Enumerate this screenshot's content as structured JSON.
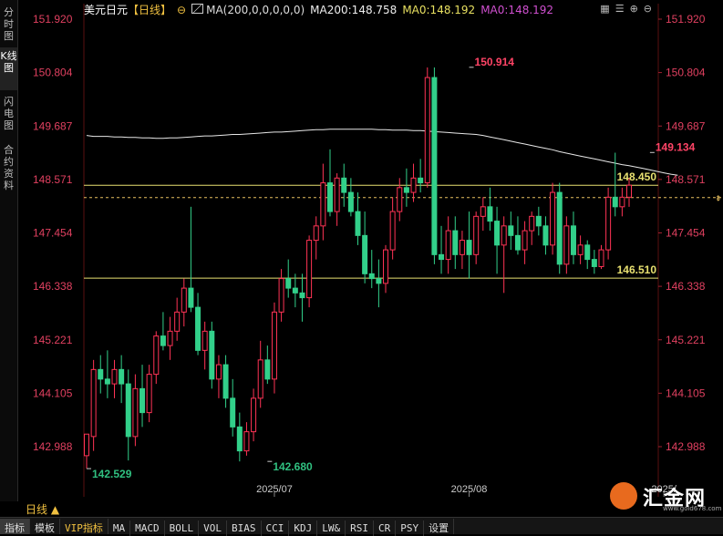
{
  "left_tabs": [
    "分时图",
    "K线图",
    "闪电图",
    "合约资料"
  ],
  "left_active": 1,
  "header": {
    "symbol": "美元日元",
    "period": "【日线】",
    "circle_glyph": "⊖",
    "ma_params": "MA(200,0,0,0,0,0)",
    "ma200": "MA200:148.758",
    "ma0_a": "MA0:148.192",
    "ma0_b": "MA0:148.192"
  },
  "toolbar_icons": [
    "grid-icon",
    "list-icon",
    "zoom-in-icon",
    "zoom-out-icon"
  ],
  "period_tab": "日线 ▲",
  "bottom_tabs": [
    "指标",
    "模板",
    "VIP指标",
    "MA",
    "MACD",
    "BOLL",
    "VOL",
    "BIAS",
    "CCI",
    "KDJ",
    "LW&",
    "RSI",
    "CR",
    "PSY",
    "设置"
  ],
  "bottom_active": 0,
  "logo": {
    "text": "汇金网",
    "url": "www.gold678.com"
  },
  "chart_data": {
    "type": "candlestick",
    "yticks": [
      "151.920",
      "150.804",
      "149.687",
      "148.571",
      "147.454",
      "146.338",
      "145.221",
      "144.105",
      "142.988"
    ],
    "ylim": [
      142.0,
      152.4
    ],
    "xlabels": [
      {
        "index": 27,
        "text": "2025/07"
      },
      {
        "index": 55,
        "text": "2025/08"
      },
      {
        "index": 83,
        "text": "2025/"
      }
    ],
    "annotations": [
      {
        "label": "150.914",
        "value": 150.914,
        "index": 55,
        "color": "#ff4466"
      },
      {
        "label": "149.134",
        "value": 149.134,
        "index": 81,
        "color": "#ff4466"
      },
      {
        "label": "142.529",
        "value": 142.529,
        "index": 0,
        "color": "#30c080"
      },
      {
        "label": "142.680",
        "value": 142.68,
        "index": 26,
        "color": "#30c080"
      }
    ],
    "hlines": [
      {
        "label": "148.450",
        "value": 148.45,
        "color": "#e8e070"
      },
      {
        "label": "146.510",
        "value": 146.51,
        "color": "#e8e070"
      }
    ],
    "current_price": 148.192,
    "ma200": [
      149.49,
      149.47,
      149.47,
      149.47,
      149.46,
      149.46,
      149.45,
      149.45,
      149.44,
      149.44,
      149.43,
      149.43,
      149.44,
      149.44,
      149.45,
      149.46,
      149.47,
      149.48,
      149.48,
      149.49,
      149.5,
      149.51,
      149.51,
      149.52,
      149.53,
      149.54,
      149.55,
      149.56,
      149.56,
      149.57,
      149.58,
      149.59,
      149.6,
      149.61,
      149.61,
      149.62,
      149.62,
      149.62,
      149.62,
      149.62,
      149.62,
      149.62,
      149.61,
      149.61,
      149.6,
      149.6,
      149.6,
      149.59,
      149.59,
      149.58,
      149.57,
      149.56,
      149.55,
      149.54,
      149.53,
      149.52,
      149.51,
      149.49,
      149.46,
      149.43,
      149.4,
      149.37,
      149.34,
      149.31,
      149.28,
      149.25,
      149.22,
      149.19,
      149.15,
      149.12,
      149.09,
      149.06,
      149.03,
      149.0,
      148.97,
      148.94,
      148.91,
      148.88,
      148.86,
      148.83,
      148.8,
      148.77,
      148.74,
      148.71,
      148.68,
      148.66
    ],
    "candles": [
      {
        "o": 142.8,
        "h": 143.2,
        "l": 142.53,
        "c": 143.25
      },
      {
        "o": 143.2,
        "h": 144.8,
        "l": 142.9,
        "c": 144.6
      },
      {
        "o": 144.6,
        "h": 144.9,
        "l": 144.1,
        "c": 144.4
      },
      {
        "o": 144.4,
        "h": 145.0,
        "l": 144.0,
        "c": 144.3
      },
      {
        "o": 144.3,
        "h": 144.8,
        "l": 144.0,
        "c": 144.6
      },
      {
        "o": 144.6,
        "h": 144.9,
        "l": 143.9,
        "c": 144.3
      },
      {
        "o": 144.3,
        "h": 144.6,
        "l": 142.7,
        "c": 143.2
      },
      {
        "o": 143.2,
        "h": 144.5,
        "l": 143.0,
        "c": 144.2
      },
      {
        "o": 144.2,
        "h": 144.7,
        "l": 143.4,
        "c": 143.7
      },
      {
        "o": 143.7,
        "h": 144.7,
        "l": 143.5,
        "c": 144.5
      },
      {
        "o": 144.5,
        "h": 145.4,
        "l": 144.3,
        "c": 145.3
      },
      {
        "o": 145.3,
        "h": 145.8,
        "l": 145.0,
        "c": 145.1
      },
      {
        "o": 145.1,
        "h": 145.7,
        "l": 144.8,
        "c": 145.4
      },
      {
        "o": 145.4,
        "h": 146.1,
        "l": 145.2,
        "c": 145.8
      },
      {
        "o": 145.8,
        "h": 146.5,
        "l": 145.5,
        "c": 146.3
      },
      {
        "o": 146.3,
        "h": 148.0,
        "l": 145.8,
        "c": 145.9
      },
      {
        "o": 145.9,
        "h": 146.2,
        "l": 144.9,
        "c": 145.0
      },
      {
        "o": 145.0,
        "h": 145.6,
        "l": 144.6,
        "c": 145.4
      },
      {
        "o": 145.4,
        "h": 145.6,
        "l": 144.2,
        "c": 144.4
      },
      {
        "o": 144.4,
        "h": 144.9,
        "l": 144.0,
        "c": 144.7
      },
      {
        "o": 144.7,
        "h": 144.9,
        "l": 143.8,
        "c": 144.0
      },
      {
        "o": 144.0,
        "h": 144.4,
        "l": 143.2,
        "c": 143.4
      },
      {
        "o": 143.4,
        "h": 143.7,
        "l": 142.68,
        "c": 142.9
      },
      {
        "o": 142.9,
        "h": 143.5,
        "l": 142.8,
        "c": 143.3
      },
      {
        "o": 143.3,
        "h": 144.2,
        "l": 143.1,
        "c": 144.0
      },
      {
        "o": 144.0,
        "h": 145.2,
        "l": 143.8,
        "c": 144.8
      },
      {
        "o": 144.8,
        "h": 145.1,
        "l": 144.3,
        "c": 144.4
      },
      {
        "o": 144.4,
        "h": 146.0,
        "l": 144.1,
        "c": 145.8
      },
      {
        "o": 145.8,
        "h": 146.7,
        "l": 145.6,
        "c": 146.5
      },
      {
        "o": 146.5,
        "h": 146.9,
        "l": 146.1,
        "c": 146.3
      },
      {
        "o": 146.3,
        "h": 146.6,
        "l": 145.9,
        "c": 146.2
      },
      {
        "o": 146.2,
        "h": 146.6,
        "l": 145.6,
        "c": 146.1
      },
      {
        "o": 146.1,
        "h": 147.4,
        "l": 145.9,
        "c": 147.3
      },
      {
        "o": 147.3,
        "h": 147.8,
        "l": 146.9,
        "c": 147.6
      },
      {
        "o": 147.6,
        "h": 148.9,
        "l": 147.3,
        "c": 148.5
      },
      {
        "o": 148.5,
        "h": 149.2,
        "l": 147.8,
        "c": 147.9
      },
      {
        "o": 147.9,
        "h": 148.7,
        "l": 147.6,
        "c": 148.6
      },
      {
        "o": 148.6,
        "h": 148.9,
        "l": 148.0,
        "c": 148.3
      },
      {
        "o": 148.3,
        "h": 148.6,
        "l": 147.8,
        "c": 147.9
      },
      {
        "o": 147.9,
        "h": 148.3,
        "l": 147.2,
        "c": 147.4
      },
      {
        "o": 147.4,
        "h": 147.9,
        "l": 146.4,
        "c": 146.6
      },
      {
        "o": 146.6,
        "h": 147.1,
        "l": 146.3,
        "c": 146.5
      },
      {
        "o": 146.5,
        "h": 146.9,
        "l": 145.9,
        "c": 146.4
      },
      {
        "o": 146.4,
        "h": 147.2,
        "l": 146.2,
        "c": 147.1
      },
      {
        "o": 147.1,
        "h": 148.2,
        "l": 146.9,
        "c": 147.9
      },
      {
        "o": 147.9,
        "h": 148.6,
        "l": 147.7,
        "c": 148.4
      },
      {
        "o": 148.4,
        "h": 148.8,
        "l": 148.0,
        "c": 148.3
      },
      {
        "o": 148.3,
        "h": 148.9,
        "l": 148.1,
        "c": 148.6
      },
      {
        "o": 148.6,
        "h": 149.0,
        "l": 148.3,
        "c": 148.5
      },
      {
        "o": 148.5,
        "h": 150.91,
        "l": 148.4,
        "c": 150.7
      },
      {
        "o": 150.7,
        "h": 150.91,
        "l": 146.8,
        "c": 147.0
      },
      {
        "o": 147.0,
        "h": 147.6,
        "l": 146.6,
        "c": 146.9
      },
      {
        "o": 146.9,
        "h": 147.8,
        "l": 146.6,
        "c": 147.5
      },
      {
        "o": 147.5,
        "h": 147.8,
        "l": 146.7,
        "c": 147.0
      },
      {
        "o": 147.0,
        "h": 147.5,
        "l": 146.7,
        "c": 147.3
      },
      {
        "o": 147.3,
        "h": 147.9,
        "l": 146.5,
        "c": 147.0
      },
      {
        "o": 147.0,
        "h": 147.9,
        "l": 146.8,
        "c": 147.8
      },
      {
        "o": 147.8,
        "h": 148.2,
        "l": 147.5,
        "c": 148.0
      },
      {
        "o": 148.0,
        "h": 148.4,
        "l": 147.5,
        "c": 147.7
      },
      {
        "o": 147.7,
        "h": 148.0,
        "l": 146.6,
        "c": 147.2
      },
      {
        "o": 147.2,
        "h": 147.8,
        "l": 146.2,
        "c": 147.6
      },
      {
        "o": 147.6,
        "h": 147.9,
        "l": 147.1,
        "c": 147.4
      },
      {
        "o": 147.4,
        "h": 147.8,
        "l": 147.0,
        "c": 147.1
      },
      {
        "o": 147.1,
        "h": 147.7,
        "l": 146.8,
        "c": 147.5
      },
      {
        "o": 147.5,
        "h": 147.9,
        "l": 147.2,
        "c": 147.8
      },
      {
        "o": 147.8,
        "h": 148.0,
        "l": 147.4,
        "c": 147.6
      },
      {
        "o": 147.6,
        "h": 147.8,
        "l": 147.0,
        "c": 147.2
      },
      {
        "o": 147.2,
        "h": 148.5,
        "l": 147.0,
        "c": 148.3
      },
      {
        "o": 148.3,
        "h": 148.5,
        "l": 146.6,
        "c": 146.8
      },
      {
        "o": 146.8,
        "h": 147.8,
        "l": 146.6,
        "c": 147.6
      },
      {
        "o": 147.6,
        "h": 147.9,
        "l": 146.8,
        "c": 147.0
      },
      {
        "o": 147.0,
        "h": 147.4,
        "l": 146.8,
        "c": 147.2
      },
      {
        "o": 147.2,
        "h": 147.3,
        "l": 146.7,
        "c": 146.9
      },
      {
        "o": 146.9,
        "h": 147.1,
        "l": 146.6,
        "c": 146.75
      },
      {
        "o": 146.75,
        "h": 147.2,
        "l": 146.7,
        "c": 147.1
      },
      {
        "o": 147.1,
        "h": 148.4,
        "l": 146.9,
        "c": 148.2
      },
      {
        "o": 148.2,
        "h": 149.13,
        "l": 147.8,
        "c": 148.0
      },
      {
        "o": 148.0,
        "h": 148.4,
        "l": 147.8,
        "c": 148.2
      },
      {
        "o": 148.2,
        "h": 148.6,
        "l": 148.0,
        "c": 148.45
      }
    ]
  }
}
